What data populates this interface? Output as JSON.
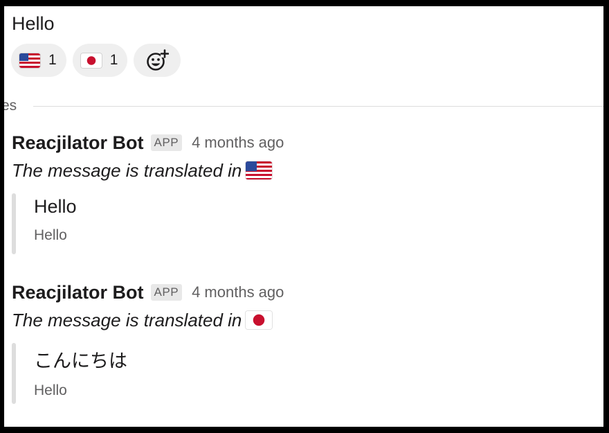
{
  "original_message": {
    "text": "Hello"
  },
  "reactions": [
    {
      "emoji": "us-flag",
      "count": "1"
    },
    {
      "emoji": "jp-flag",
      "count": "1"
    }
  ],
  "add_reaction_icon": "add-emoji-icon",
  "divider": {
    "label": "es"
  },
  "messages": [
    {
      "sender": "Reacjilator Bot",
      "badge": "APP",
      "time": "4 months ago",
      "intro": "The message is translated in",
      "flag": "us-flag",
      "attachment": {
        "title": "Hello",
        "subtitle": "Hello"
      }
    },
    {
      "sender": "Reacjilator Bot",
      "badge": "APP",
      "time": "4 months ago",
      "intro": "The message is translated in",
      "flag": "jp-flag",
      "attachment": {
        "title": "こんにちは",
        "subtitle": "Hello"
      }
    }
  ],
  "colors": {
    "accent_red": "#c8102e",
    "blue": "#2b4a9b",
    "muted_text": "#616061",
    "pill_bg": "#efefef"
  }
}
